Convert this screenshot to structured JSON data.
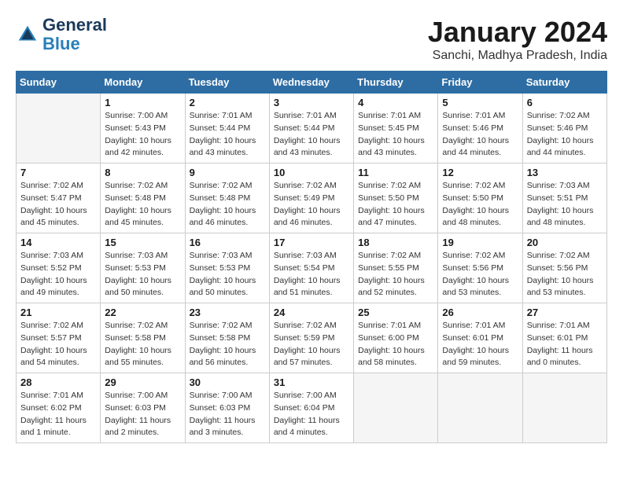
{
  "header": {
    "logo_line1": "General",
    "logo_line2": "Blue",
    "month": "January 2024",
    "location": "Sanchi, Madhya Pradesh, India"
  },
  "days_of_week": [
    "Sunday",
    "Monday",
    "Tuesday",
    "Wednesday",
    "Thursday",
    "Friday",
    "Saturday"
  ],
  "weeks": [
    [
      {
        "day": "",
        "info": ""
      },
      {
        "day": "1",
        "info": "Sunrise: 7:00 AM\nSunset: 5:43 PM\nDaylight: 10 hours\nand 42 minutes."
      },
      {
        "day": "2",
        "info": "Sunrise: 7:01 AM\nSunset: 5:44 PM\nDaylight: 10 hours\nand 43 minutes."
      },
      {
        "day": "3",
        "info": "Sunrise: 7:01 AM\nSunset: 5:44 PM\nDaylight: 10 hours\nand 43 minutes."
      },
      {
        "day": "4",
        "info": "Sunrise: 7:01 AM\nSunset: 5:45 PM\nDaylight: 10 hours\nand 43 minutes."
      },
      {
        "day": "5",
        "info": "Sunrise: 7:01 AM\nSunset: 5:46 PM\nDaylight: 10 hours\nand 44 minutes."
      },
      {
        "day": "6",
        "info": "Sunrise: 7:02 AM\nSunset: 5:46 PM\nDaylight: 10 hours\nand 44 minutes."
      }
    ],
    [
      {
        "day": "7",
        "info": "Sunrise: 7:02 AM\nSunset: 5:47 PM\nDaylight: 10 hours\nand 45 minutes."
      },
      {
        "day": "8",
        "info": "Sunrise: 7:02 AM\nSunset: 5:48 PM\nDaylight: 10 hours\nand 45 minutes."
      },
      {
        "day": "9",
        "info": "Sunrise: 7:02 AM\nSunset: 5:48 PM\nDaylight: 10 hours\nand 46 minutes."
      },
      {
        "day": "10",
        "info": "Sunrise: 7:02 AM\nSunset: 5:49 PM\nDaylight: 10 hours\nand 46 minutes."
      },
      {
        "day": "11",
        "info": "Sunrise: 7:02 AM\nSunset: 5:50 PM\nDaylight: 10 hours\nand 47 minutes."
      },
      {
        "day": "12",
        "info": "Sunrise: 7:02 AM\nSunset: 5:50 PM\nDaylight: 10 hours\nand 48 minutes."
      },
      {
        "day": "13",
        "info": "Sunrise: 7:03 AM\nSunset: 5:51 PM\nDaylight: 10 hours\nand 48 minutes."
      }
    ],
    [
      {
        "day": "14",
        "info": "Sunrise: 7:03 AM\nSunset: 5:52 PM\nDaylight: 10 hours\nand 49 minutes."
      },
      {
        "day": "15",
        "info": "Sunrise: 7:03 AM\nSunset: 5:53 PM\nDaylight: 10 hours\nand 50 minutes."
      },
      {
        "day": "16",
        "info": "Sunrise: 7:03 AM\nSunset: 5:53 PM\nDaylight: 10 hours\nand 50 minutes."
      },
      {
        "day": "17",
        "info": "Sunrise: 7:03 AM\nSunset: 5:54 PM\nDaylight: 10 hours\nand 51 minutes."
      },
      {
        "day": "18",
        "info": "Sunrise: 7:02 AM\nSunset: 5:55 PM\nDaylight: 10 hours\nand 52 minutes."
      },
      {
        "day": "19",
        "info": "Sunrise: 7:02 AM\nSunset: 5:56 PM\nDaylight: 10 hours\nand 53 minutes."
      },
      {
        "day": "20",
        "info": "Sunrise: 7:02 AM\nSunset: 5:56 PM\nDaylight: 10 hours\nand 53 minutes."
      }
    ],
    [
      {
        "day": "21",
        "info": "Sunrise: 7:02 AM\nSunset: 5:57 PM\nDaylight: 10 hours\nand 54 minutes."
      },
      {
        "day": "22",
        "info": "Sunrise: 7:02 AM\nSunset: 5:58 PM\nDaylight: 10 hours\nand 55 minutes."
      },
      {
        "day": "23",
        "info": "Sunrise: 7:02 AM\nSunset: 5:58 PM\nDaylight: 10 hours\nand 56 minutes."
      },
      {
        "day": "24",
        "info": "Sunrise: 7:02 AM\nSunset: 5:59 PM\nDaylight: 10 hours\nand 57 minutes."
      },
      {
        "day": "25",
        "info": "Sunrise: 7:01 AM\nSunset: 6:00 PM\nDaylight: 10 hours\nand 58 minutes."
      },
      {
        "day": "26",
        "info": "Sunrise: 7:01 AM\nSunset: 6:01 PM\nDaylight: 10 hours\nand 59 minutes."
      },
      {
        "day": "27",
        "info": "Sunrise: 7:01 AM\nSunset: 6:01 PM\nDaylight: 11 hours\nand 0 minutes."
      }
    ],
    [
      {
        "day": "28",
        "info": "Sunrise: 7:01 AM\nSunset: 6:02 PM\nDaylight: 11 hours\nand 1 minute."
      },
      {
        "day": "29",
        "info": "Sunrise: 7:00 AM\nSunset: 6:03 PM\nDaylight: 11 hours\nand 2 minutes."
      },
      {
        "day": "30",
        "info": "Sunrise: 7:00 AM\nSunset: 6:03 PM\nDaylight: 11 hours\nand 3 minutes."
      },
      {
        "day": "31",
        "info": "Sunrise: 7:00 AM\nSunset: 6:04 PM\nDaylight: 11 hours\nand 4 minutes."
      },
      {
        "day": "",
        "info": ""
      },
      {
        "day": "",
        "info": ""
      },
      {
        "day": "",
        "info": ""
      }
    ]
  ]
}
